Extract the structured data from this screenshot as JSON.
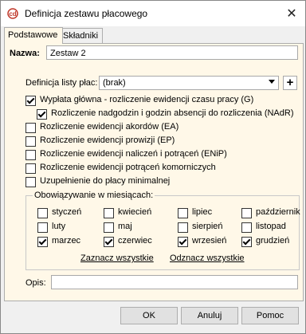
{
  "window": {
    "title": "Definicja zestawu płacowego",
    "close_glyph": "✕"
  },
  "tabs": [
    {
      "label": "Podstawowe",
      "active": true
    },
    {
      "label": "Składniki",
      "active": false
    }
  ],
  "form": {
    "name_label": "Nazwa:",
    "name_value": "Zestaw 2",
    "list_def_label": "Definicja listy płac:",
    "list_def_value": "(brak)",
    "plus_label": "+"
  },
  "checkboxes": [
    {
      "label": "Wypłata główna - rozliczenie ewidencji czasu pracy (G)",
      "checked": true
    },
    {
      "label": "Rozliczenie nadgodzin i godzin absencji do rozliczenia (NAdR)",
      "checked": true
    },
    {
      "label": "Rozliczenie ewidencji akordów (EA)",
      "checked": false
    },
    {
      "label": "Rozliczenie ewidencji prowizji (EP)",
      "checked": false
    },
    {
      "label": "Rozliczenie ewidencji naliczeń i potrąceń (ENiP)",
      "checked": false
    },
    {
      "label": "Rozliczenie ewidencji potrąceń komorniczych",
      "checked": false
    },
    {
      "label": "Uzupełnienie do płacy minimalnej",
      "checked": false
    }
  ],
  "months_group": {
    "title": "Obowiązywanie w miesiącach:",
    "months": [
      {
        "label": "styczeń",
        "checked": false
      },
      {
        "label": "kwiecień",
        "checked": false
      },
      {
        "label": "lipiec",
        "checked": false
      },
      {
        "label": "październik",
        "checked": false
      },
      {
        "label": "luty",
        "checked": false
      },
      {
        "label": "maj",
        "checked": false
      },
      {
        "label": "sierpień",
        "checked": false
      },
      {
        "label": "listopad",
        "checked": false
      },
      {
        "label": "marzec",
        "checked": true
      },
      {
        "label": "czerwiec",
        "checked": true
      },
      {
        "label": "wrzesień",
        "checked": true
      },
      {
        "label": "grudzień",
        "checked": true
      }
    ],
    "select_all": "Zaznacz wszystkie",
    "deselect_all": "Odznacz wszystkie"
  },
  "description": {
    "label": "Opis:",
    "value": ""
  },
  "buttons": {
    "ok": "OK",
    "cancel": "Anuluj",
    "help": "Pomoc"
  },
  "colors": {
    "panel_bg": "#fff8e8",
    "window_bg": "#f0f0f0"
  },
  "icons": {
    "app": "app-logo-icon",
    "close": "close-icon",
    "dropdown": "chevron-down-icon"
  }
}
